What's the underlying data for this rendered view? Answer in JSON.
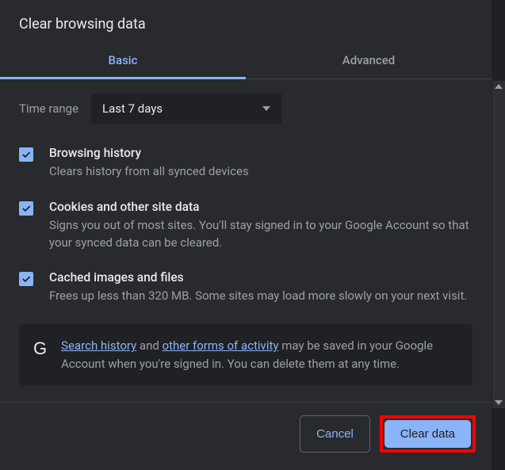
{
  "title": "Clear browsing data",
  "tabs": {
    "basic": "Basic",
    "advanced": "Advanced"
  },
  "timeRange": {
    "label": "Time range",
    "value": "Last 7 days"
  },
  "options": [
    {
      "title": "Browsing history",
      "desc": "Clears history from all synced devices",
      "checked": true
    },
    {
      "title": "Cookies and other site data",
      "desc": "Signs you out of most sites. You'll stay signed in to your Google Account so that your synced data can be cleared.",
      "checked": true
    },
    {
      "title": "Cached images and files",
      "desc": "Frees up less than 320 MB. Some sites may load more slowly on your next visit.",
      "checked": true
    }
  ],
  "info": {
    "link1": "Search history",
    "mid1": " and ",
    "link2": "other forms of activity",
    "rest": " may be saved in your Google Account when you're signed in. You can delete them at any time."
  },
  "buttons": {
    "cancel": "Cancel",
    "clear": "Clear data"
  }
}
